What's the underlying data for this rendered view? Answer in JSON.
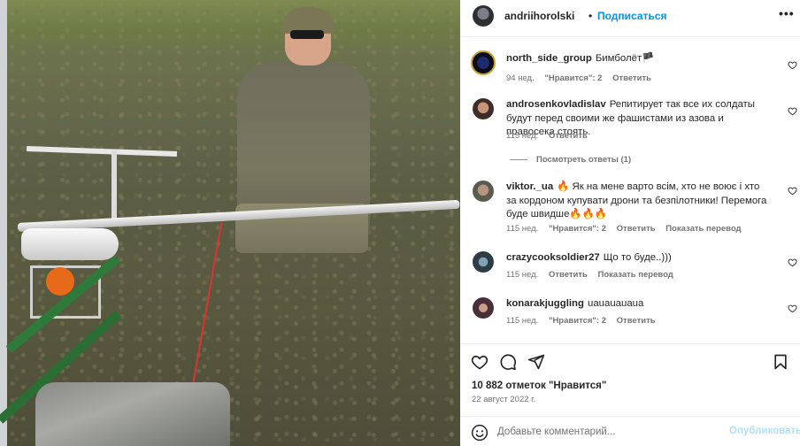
{
  "header": {
    "username": "andriihorolski",
    "separator": "•",
    "follow_label": "Подписаться",
    "more_label": "•••"
  },
  "comments": [
    {
      "username": "north_side_group",
      "text": "Бимболёт🏴",
      "time": "94 нед.",
      "likes": "\"Нравится\": 2",
      "reply": "Ответить",
      "translate": ""
    },
    {
      "username": "androsenkovladislav",
      "text": "Репитирует так все их солдаты будут перед своими же фашистами из азова и правосека стоять.",
      "time": "115 нед.",
      "likes": "",
      "reply": "Ответить",
      "translate": ""
    },
    {
      "username": "viktor._ua",
      "text": "🔥 Як на мене варто всім, хто не воює і хто за кордоном купувати дрони та безпілотники! Перемога буде швидше🔥🔥🔥",
      "time": "115 нед.",
      "likes": "\"Нравится\": 2",
      "reply": "Ответить",
      "translate": "Показать перевод"
    },
    {
      "username": "crazycooksoldier27",
      "text": "Що то буде..)))",
      "time": "115 нед.",
      "likes": "",
      "reply": "Ответить",
      "translate": "Показать перевод"
    },
    {
      "username": "konarakjuggling",
      "text": "uauauauaua",
      "time": "115 нед.",
      "likes": "\"Нравится\": 2",
      "reply": "Ответить",
      "translate": ""
    }
  ],
  "view_replies": "Посмотреть ответы (1)",
  "post": {
    "likes": "10 882 отметок \"Нравится\"",
    "date": "22 август 2022 г."
  },
  "composer": {
    "placeholder": "Добавьте комментарий...",
    "post_label": "Опубликовать"
  },
  "icons": [
    "heart-icon",
    "comment-icon",
    "share-icon",
    "bookmark-icon",
    "emoji-icon",
    "more-icon"
  ],
  "colors": {
    "accent": "#0095f6",
    "post_disabled": "#b2dffc",
    "meta": "#737373",
    "text": "#262626"
  }
}
